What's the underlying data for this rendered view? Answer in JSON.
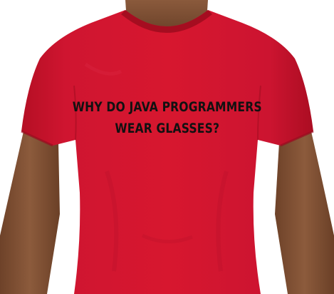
{
  "shirt": {
    "color": "#d0142b",
    "print": {
      "line1": "WHY DO JAVA PROGRAMMERS",
      "line2": "WEAR GLASSES?",
      "ink_color": "#111111"
    }
  },
  "background_color": "#ffffff"
}
